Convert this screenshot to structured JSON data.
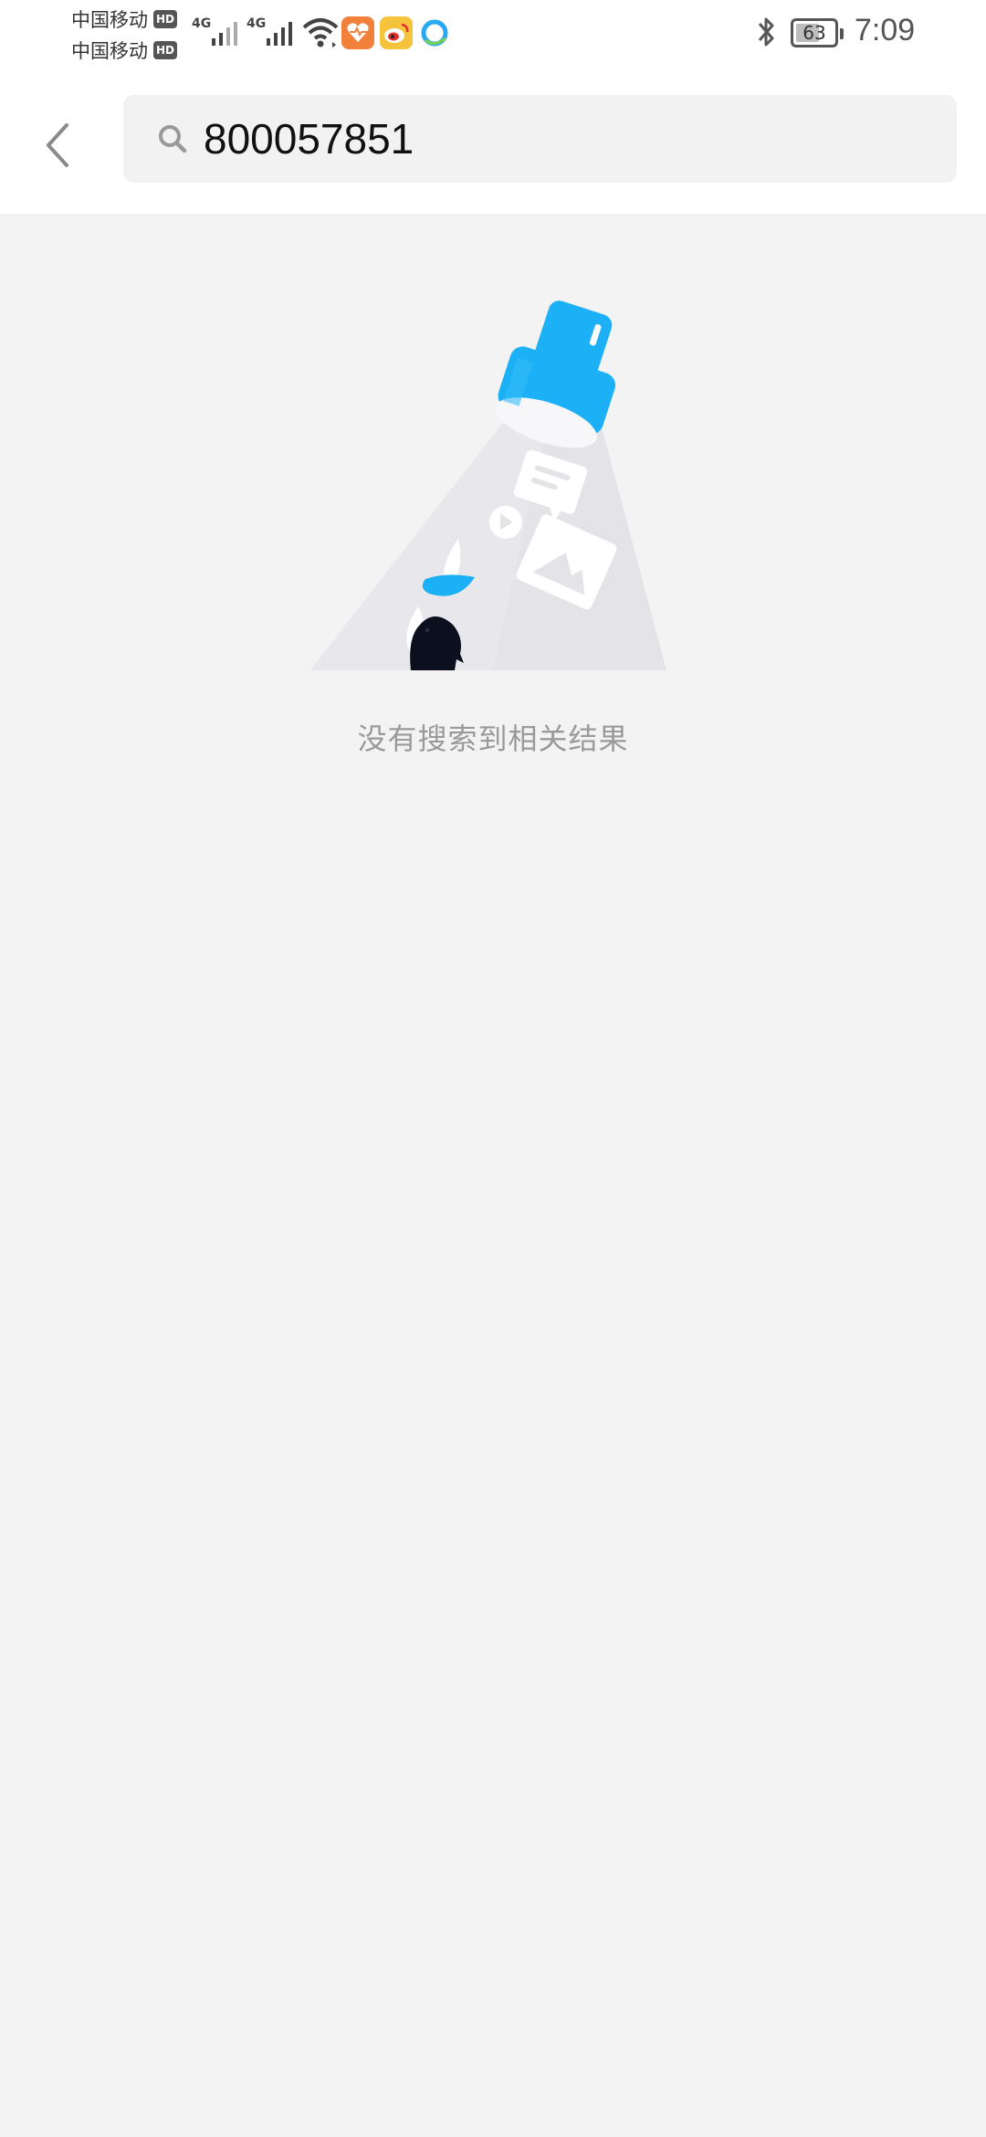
{
  "status_bar": {
    "carriers": [
      {
        "name": "中国移动",
        "badge": "HD"
      },
      {
        "name": "中国移动",
        "badge": "HD"
      }
    ],
    "network_types": [
      "4G",
      "4G"
    ],
    "battery_level": "63",
    "time": "7:09",
    "icons": [
      "wifi-icon",
      "health-app-icon",
      "weibo-icon",
      "qq-browser-icon",
      "bluetooth-icon",
      "battery-icon"
    ],
    "colors": {
      "health_app": "#f0803a",
      "weibo": "#f6c33c",
      "qq_browser": "#2aa8f2"
    }
  },
  "header": {
    "back_icon": "chevron-left-icon",
    "search": {
      "icon": "search-icon",
      "query": "800057851"
    }
  },
  "empty_state": {
    "illustration": "flashlight-empty-illustration",
    "message": "没有搜索到相关结果",
    "colors": {
      "flashlight": "#1cb0f6",
      "beam": "#e3e3e8",
      "penguin": "#0b0f1e"
    }
  }
}
